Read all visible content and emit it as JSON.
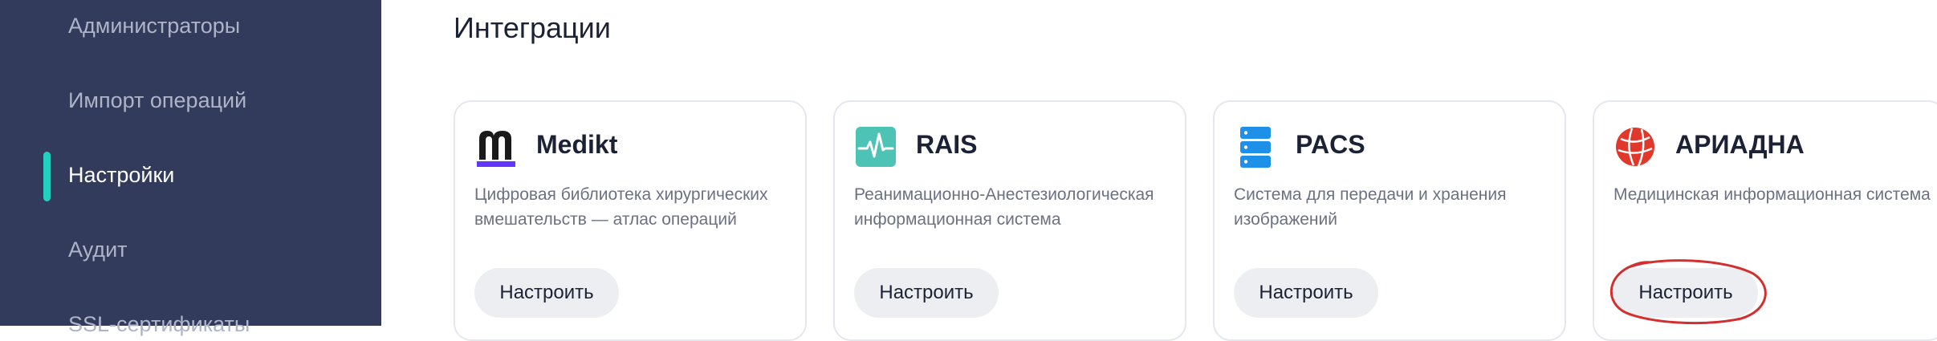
{
  "sidebar": {
    "items": [
      {
        "label": "Администраторы"
      },
      {
        "label": "Импорт операций"
      },
      {
        "label": "Настройки"
      },
      {
        "label": "Аудит"
      },
      {
        "label": "SSL-сертификаты"
      }
    ],
    "active_index": 2,
    "colors": {
      "background": "#333b5c",
      "accent": "#23d0c0"
    }
  },
  "main": {
    "title": "Интеграции",
    "cards": [
      {
        "name": "Medikt",
        "icon": "medikt-logo-icon",
        "description": "Цифровая библиотека хирургических вмешательств — атлас операций",
        "button": "Настроить"
      },
      {
        "name": "RAIS",
        "icon": "heartbeat-icon",
        "description": "Реанимационно-Анестезиологическая информационная система",
        "button": "Настроить"
      },
      {
        "name": "PACS",
        "icon": "server-stack-icon",
        "description": "Система для передачи и хранения изображений",
        "button": "Настроить"
      },
      {
        "name": "АРИАДНА",
        "icon": "globe-icon",
        "description": "Медицинская информационная система",
        "button": "Настроить"
      }
    ]
  },
  "annotation": {
    "type": "circle-highlight",
    "target": "ariadna-configure-button",
    "color": "#d32f2f"
  }
}
